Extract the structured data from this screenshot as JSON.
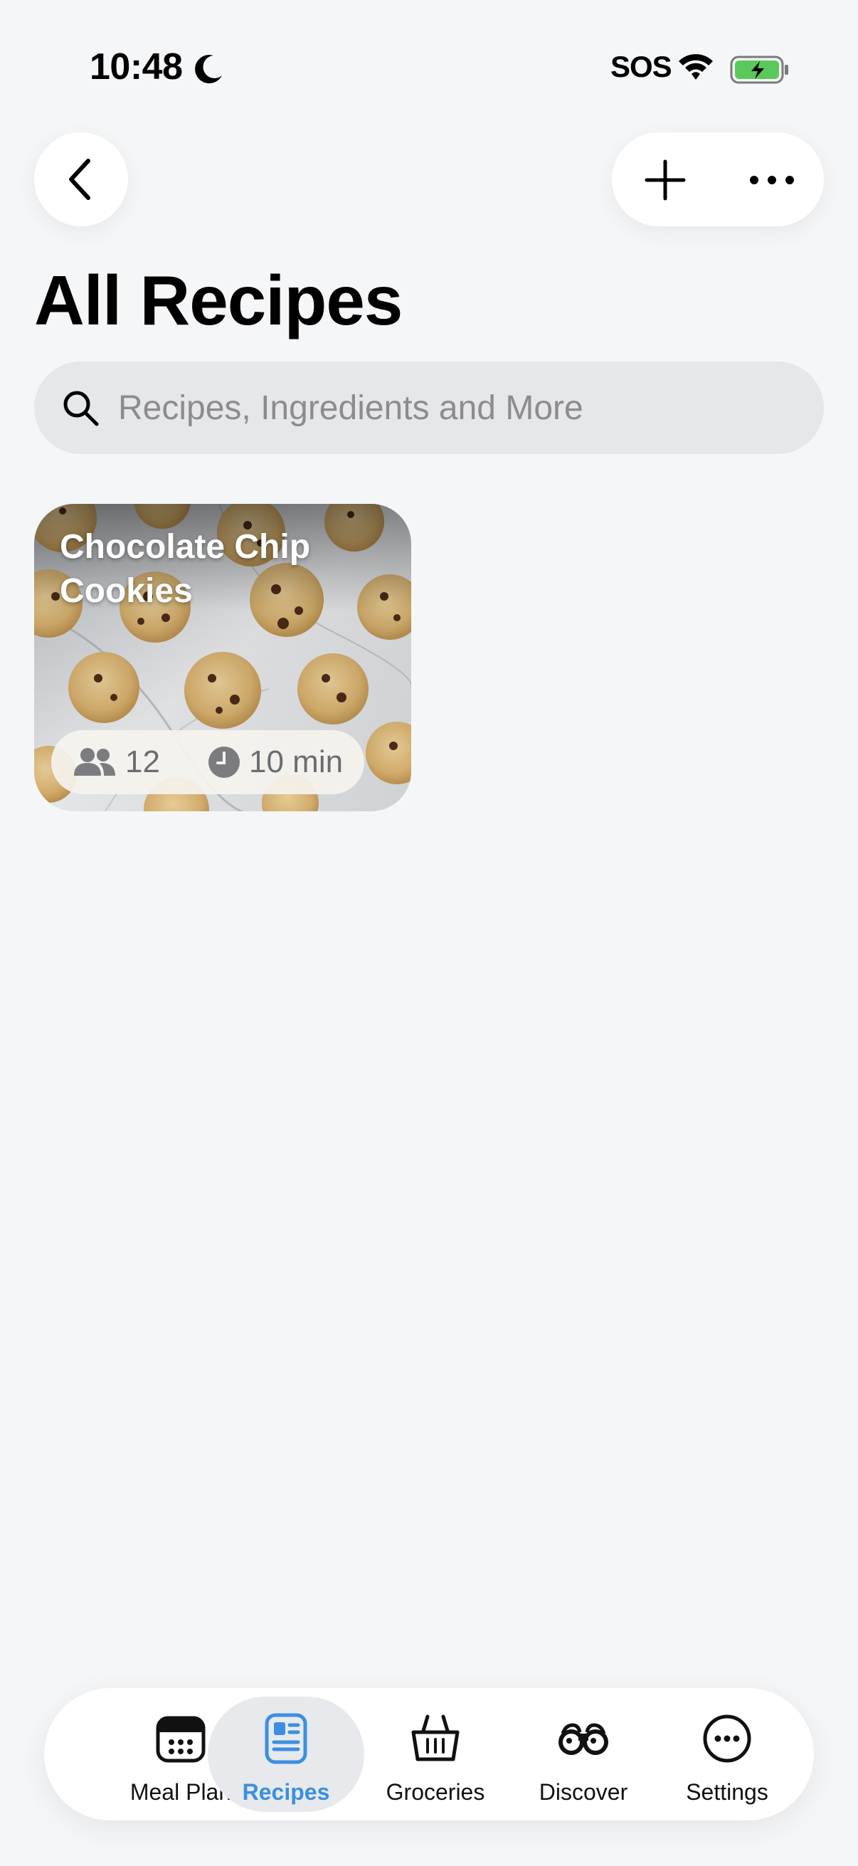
{
  "status_bar": {
    "time": "10:48",
    "carrier": "SOS",
    "battery_color": "#5ac85a"
  },
  "header": {
    "title": "All Recipes"
  },
  "search": {
    "placeholder": "Recipes, Ingredients and More",
    "value": ""
  },
  "recipes": [
    {
      "title": "Chocolate Chip Cookies",
      "servings": "12",
      "duration": "10 min"
    }
  ],
  "tabs": [
    {
      "label": "Meal Plan",
      "icon": "calendar-icon",
      "active": false
    },
    {
      "label": "Recipes",
      "icon": "recipe-book-icon",
      "active": true
    },
    {
      "label": "Groceries",
      "icon": "basket-icon",
      "active": false
    },
    {
      "label": "Discover",
      "icon": "binoculars-icon",
      "active": false
    },
    {
      "label": "Settings",
      "icon": "ellipsis-circle-icon",
      "active": false
    }
  ],
  "colors": {
    "accent": "#3b8fe0",
    "background": "#f5f6f8"
  }
}
